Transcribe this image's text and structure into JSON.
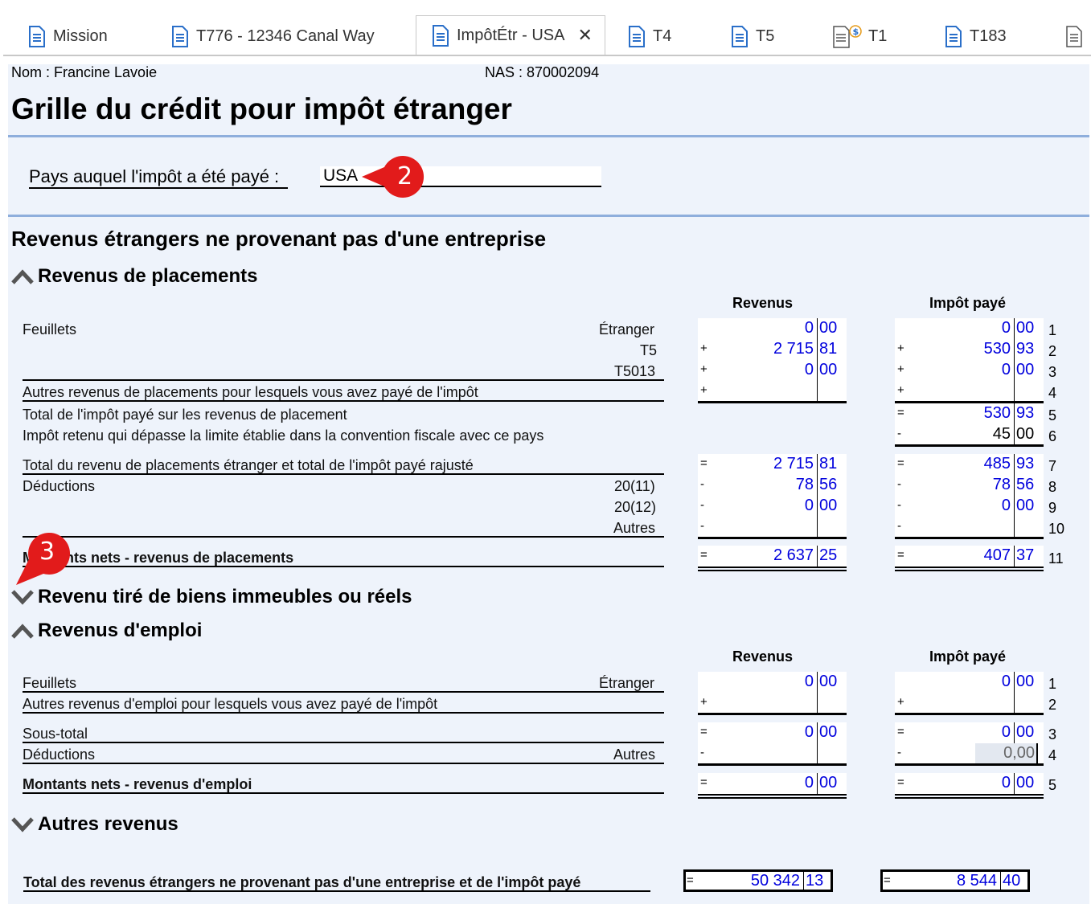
{
  "tabs": [
    {
      "label": "Mission"
    },
    {
      "label": "T776 - 12346 Canal Way"
    },
    {
      "label": "ImpôtÉtr - USA",
      "close": "✕"
    },
    {
      "label": "T4"
    },
    {
      "label": "T5"
    },
    {
      "label": "T1"
    },
    {
      "label": "T183"
    }
  ],
  "header": {
    "name": "Nom : Francine Lavoie",
    "sin": "NAS : 870002094",
    "title": "Grille du crédit pour impôt étranger"
  },
  "country": {
    "label": "Pays auquel l'impôt a été payé :",
    "value": "USA"
  },
  "callouts": {
    "two": "2",
    "three": "3"
  },
  "section": {
    "title": "Revenus étrangers ne provenant pas d'une entreprise",
    "col_revenue": "Revenus",
    "col_tax": "Impôt payé"
  },
  "placements": {
    "title": "Revenus de placements",
    "feuillets": "Feuillets",
    "etranger": "Étranger",
    "t5": "T5",
    "t5013": "T5013",
    "autres_revenus": "Autres revenus de placements pour lesquels vous avez payé de l'impôt",
    "total_impot": "Total de l'impôt payé sur les revenus de placement",
    "impot_retenu": "Impôt retenu qui dépasse la limite établie dans la convention fiscale avec ce pays",
    "total_rajuste": "Total du revenu de placements étranger et total de l'impôt payé rajusté",
    "deductions": "Déductions",
    "d2011": "20(11)",
    "d2012": "20(12)",
    "autres": "Autres",
    "montants_nets": "Montants nets - revenus de placements",
    "rev": {
      "r1": [
        "0",
        "00"
      ],
      "r2": [
        "2 715",
        "81"
      ],
      "r3": [
        "0",
        "00"
      ],
      "r4": [
        "",
        ""
      ],
      "r7": [
        "2 715",
        "81"
      ],
      "r8": [
        "78",
        "56"
      ],
      "r9": [
        "0",
        "00"
      ],
      "r10": [
        "",
        ""
      ],
      "r11": [
        "2 637",
        "25"
      ]
    },
    "tax": {
      "r1": [
        "0",
        "00"
      ],
      "r2": [
        "530",
        "93"
      ],
      "r3": [
        "0",
        "00"
      ],
      "r4": [
        "",
        ""
      ],
      "r5": [
        "530",
        "93"
      ],
      "r6": [
        "45",
        "00"
      ],
      "r7": [
        "485",
        "93"
      ],
      "r8": [
        "78",
        "56"
      ],
      "r9": [
        "0",
        "00"
      ],
      "r10": [
        "",
        ""
      ],
      "r11": [
        "407",
        "37"
      ]
    },
    "line_numbers": [
      "1",
      "2",
      "3",
      "4",
      "5",
      "6",
      "7",
      "8",
      "9",
      "10",
      "11"
    ]
  },
  "immeubles": {
    "title": "Revenu tiré de biens immeubles ou réels"
  },
  "emploi": {
    "title": "Revenus d'emploi",
    "feuillets": "Feuillets",
    "etranger": "Étranger",
    "autres_revenus": "Autres revenus d'emploi pour lesquels vous avez payé de l'impôt",
    "sous_total": "Sous-total",
    "deductions": "Déductions",
    "autres": "Autres",
    "montants_nets": "Montants nets - revenus d'emploi",
    "rev": {
      "r1": [
        "0",
        "00"
      ],
      "r2": [
        "",
        ""
      ],
      "r3": [
        "0",
        "00"
      ],
      "r4": [
        "",
        ""
      ],
      "r5": [
        "0",
        "00"
      ]
    },
    "tax": {
      "r1": [
        "0",
        "00"
      ],
      "r2": [
        "",
        ""
      ],
      "r3": [
        "0",
        "00"
      ],
      "r4": "0,00",
      "r5": [
        "0",
        "00"
      ]
    },
    "line_numbers": [
      "1",
      "2",
      "3",
      "4",
      "5"
    ]
  },
  "autres_revenus": {
    "title": "Autres revenus"
  },
  "total": {
    "label": "Total des revenus étrangers ne provenant pas d'une entreprise et de l'impôt payé",
    "rev": [
      "50 342",
      "13"
    ],
    "tax": [
      "8 544",
      "40"
    ]
  },
  "signs": {
    "plus": "+",
    "minus": "-",
    "equals": "="
  },
  "colors": {
    "panel": "#eef3fb",
    "rule": "#8eaedc",
    "value": "#0000dd",
    "callout": "#e21b1b"
  }
}
